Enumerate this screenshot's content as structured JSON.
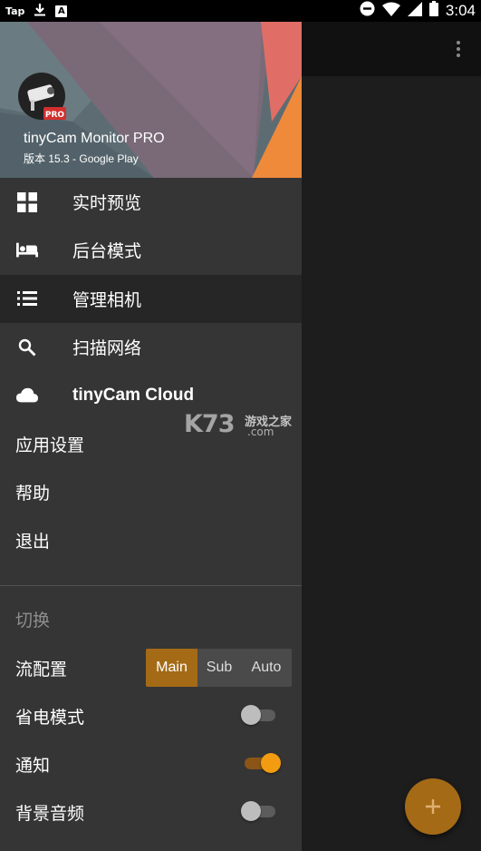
{
  "status_bar": {
    "left_label": "Tap",
    "a_label": "A",
    "time": "3:04"
  },
  "drawer": {
    "app_name": "tinyCam Monitor PRO",
    "version": "版本 15.3 - Google Play",
    "logo_badge": "PRO",
    "menu": [
      {
        "icon": "grid-icon",
        "label": "实时预览"
      },
      {
        "icon": "bed-icon",
        "label": "后台模式"
      },
      {
        "icon": "list-icon",
        "label": "管理相机"
      },
      {
        "icon": "search-icon",
        "label": "扫描网络"
      },
      {
        "icon": "cloud-icon",
        "label": "tinyCam Cloud"
      }
    ],
    "plain_menu": [
      {
        "label": "应用设置"
      },
      {
        "label": "帮助"
      },
      {
        "label": "退出"
      }
    ],
    "section_title": "切换",
    "settings": {
      "stream": {
        "label": "流配置",
        "options": [
          "Main",
          "Sub",
          "Auto"
        ],
        "selected": "Main"
      },
      "power_save": {
        "label": "省电模式",
        "on": false
      },
      "notification": {
        "label": "通知",
        "on": true
      },
      "background_audio": {
        "label": "背景音频",
        "on": false
      }
    }
  },
  "watermark": {
    "brand": "K73",
    "cn": "游戏之家",
    "domain": ".com"
  },
  "colors": {
    "accent": "#a56a16",
    "toggle_on": "#f39c12",
    "drawer_bg": "#353535",
    "active_row": "#262626"
  }
}
